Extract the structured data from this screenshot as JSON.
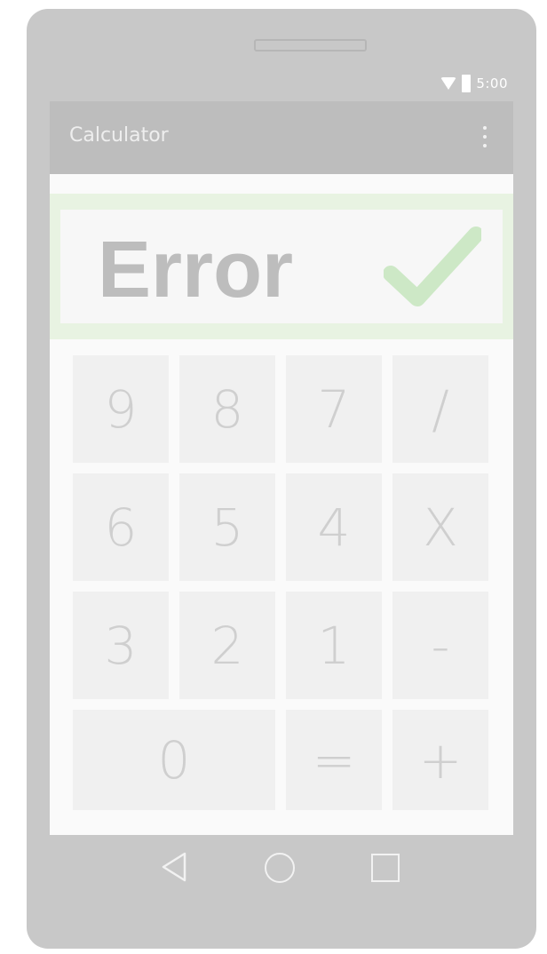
{
  "status_bar": {
    "time": "5:00",
    "wifi_icon": "wifi-icon",
    "battery_icon": "battery-icon"
  },
  "app_bar": {
    "title": "Calculator",
    "menu_icon": "overflow-menu-icon"
  },
  "display": {
    "value": "Error",
    "status_icon": "check-icon",
    "accent_color": "#9ed69a"
  },
  "keypad": {
    "keys": [
      {
        "label": "9",
        "name": "key-9"
      },
      {
        "label": "8",
        "name": "key-8"
      },
      {
        "label": "7",
        "name": "key-7"
      },
      {
        "label": "/",
        "name": "key-divide"
      },
      {
        "label": "6",
        "name": "key-6"
      },
      {
        "label": "5",
        "name": "key-5"
      },
      {
        "label": "4",
        "name": "key-4"
      },
      {
        "label": "X",
        "name": "key-multiply"
      },
      {
        "label": "3",
        "name": "key-3"
      },
      {
        "label": "2",
        "name": "key-2"
      },
      {
        "label": "1",
        "name": "key-1"
      },
      {
        "label": "-",
        "name": "key-subtract"
      },
      {
        "label": "0",
        "name": "key-0"
      },
      {
        "label": "=",
        "name": "key-equals"
      },
      {
        "label": "+",
        "name": "key-add"
      }
    ]
  },
  "nav_bar": {
    "back_icon": "back-icon",
    "home_icon": "home-icon",
    "recents_icon": "recents-icon"
  }
}
